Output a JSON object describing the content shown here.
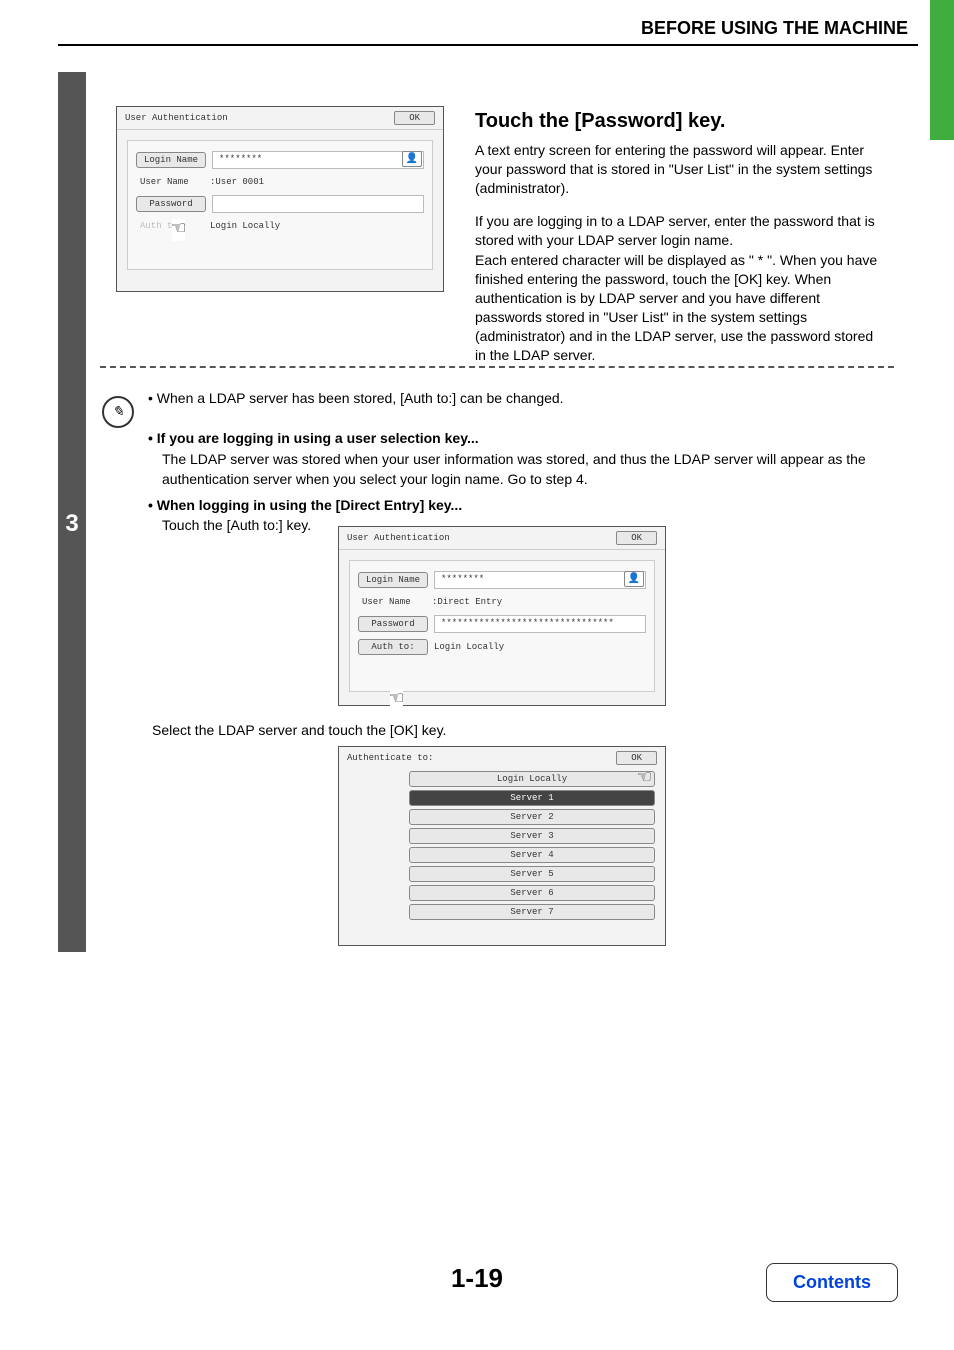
{
  "header": {
    "title": "BEFORE USING THE MACHINE"
  },
  "step_number": "3",
  "dialog1": {
    "title": "User Authentication",
    "ok": "OK",
    "login_name_label": "Login Name",
    "login_name_value": "********",
    "user_name_label": "User Name",
    "user_name_value": ":User 0001",
    "password_label": "Password",
    "auth_label": "Auth to:",
    "auth_value": "Login Locally"
  },
  "explain": {
    "heading": "Touch the [Password] key.",
    "p1": "A text entry screen for entering the password will appear. Enter your password that is stored in \"User List\" in the system settings (administrator).",
    "p2": "If you are logging in to a LDAP server, enter the password that is stored with your LDAP server login name.",
    "p3": "Each entered character will be displayed as \" * \". When you have finished entering the password, touch the [OK] key. When authentication is by LDAP server and you have different passwords stored in \"User List\" in the system settings (administrator) and in the LDAP server, use the password stored in the LDAP server."
  },
  "notes": {
    "line1": "• When a LDAP server has been stored, [Auth to:] can be changed.",
    "b1_lead": "• If you are logging in using a user selection key...",
    "b1_body": "The LDAP server was stored when your user information was stored, and thus the LDAP server will appear as the authentication server when you select your login name. Go to step 4.",
    "b2_lead": "• When logging in using the [Direct Entry] key...",
    "b2_body": "Touch the [Auth to:] key."
  },
  "dialog2": {
    "title": "User Authentication",
    "ok": "OK",
    "login_name_label": "Login Name",
    "login_name_value": "********",
    "user_name_label": "User Name",
    "user_name_value": ":Direct Entry",
    "password_label": "Password",
    "password_value": "********************************",
    "auth_label": "Auth to:",
    "auth_value": "Login Locally"
  },
  "mid_note": "Select the LDAP server and touch the [OK] key.",
  "dialog3": {
    "title": "Authenticate to:",
    "ok": "OK",
    "servers": [
      "Login Locally",
      "Server 1",
      "Server 2",
      "Server 3",
      "Server 4",
      "Server 5",
      "Server 6",
      "Server 7"
    ],
    "selected_index": 1
  },
  "footer": {
    "page": "1-19",
    "contents": "Contents"
  }
}
